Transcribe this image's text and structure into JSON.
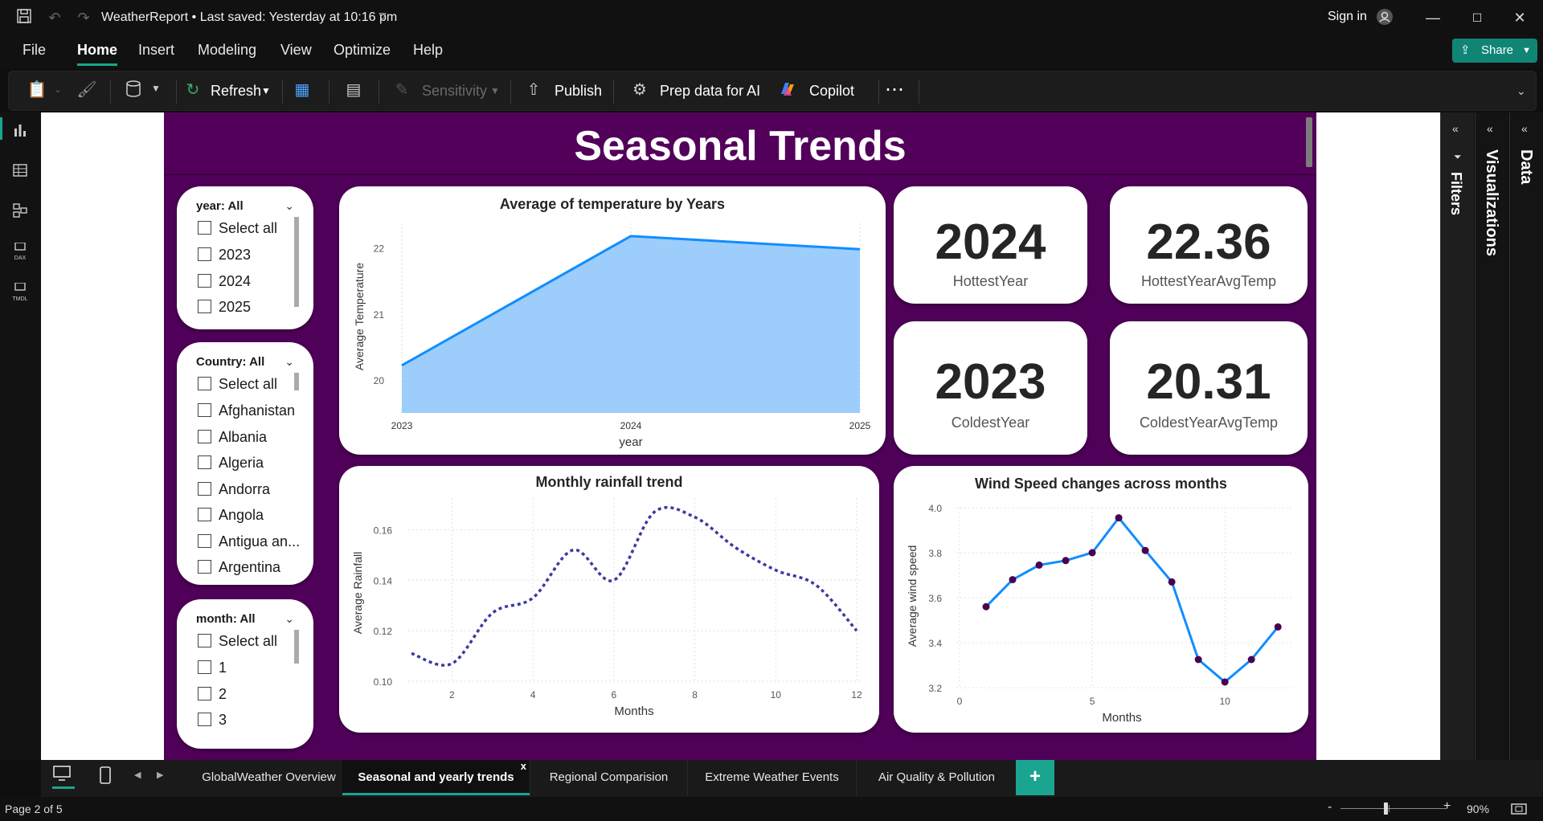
{
  "titlebar": {
    "title": "WeatherReport • Last saved: Yesterday at 10:16 pm",
    "sign_in": "Sign in"
  },
  "menu": {
    "items": [
      "File",
      "Home",
      "Insert",
      "Modeling",
      "View",
      "Optimize",
      "Help"
    ],
    "active": "Home",
    "share": "Share"
  },
  "ribbon": {
    "refresh": "Refresh",
    "sensitivity": "Sensitivity",
    "publish": "Publish",
    "prep_ai": "Prep data for AI",
    "copilot": "Copilot",
    "more": "⋯"
  },
  "report": {
    "title": "Seasonal Trends"
  },
  "slicers": {
    "year": {
      "header": "year: All",
      "items": [
        "Select all",
        "2023",
        "2024",
        "2025"
      ]
    },
    "country": {
      "header": "Country: All",
      "items": [
        "Select all",
        "Afghanistan",
        "Albania",
        "Algeria",
        "Andorra",
        "Angola",
        "Antigua an...",
        "Argentina"
      ]
    },
    "month": {
      "header": "month: All",
      "items": [
        "Select all",
        "1",
        "2",
        "3"
      ]
    }
  },
  "kpis": [
    {
      "value": "2024",
      "label": "HottestYear"
    },
    {
      "value": "22.36",
      "label": "HottestYearAvgTemp"
    },
    {
      "value": "2023",
      "label": "ColdestYear"
    },
    {
      "value": "20.31",
      "label": "ColdestYearAvgTemp"
    }
  ],
  "chart_data": [
    {
      "type": "area",
      "title": "Average of temperature by Years",
      "xlabel": "year",
      "ylabel": "Average Temperature",
      "categories": [
        "2023",
        "2024",
        "2025"
      ],
      "values": [
        20.22,
        22.18,
        21.98
      ],
      "yticks": [
        20,
        21,
        22
      ],
      "ylim": [
        19.5,
        22.3
      ],
      "colors": {
        "line": "#118dff",
        "fill": "#9ccdfb"
      }
    },
    {
      "type": "line",
      "title": "Monthly rainfall trend",
      "xlabel": "Months",
      "ylabel": "Average Rainfall",
      "x": [
        1,
        2,
        3,
        4,
        5,
        6,
        7,
        8,
        9,
        10,
        11,
        12
      ],
      "values": [
        0.111,
        0.107,
        0.127,
        0.133,
        0.152,
        0.14,
        0.167,
        0.165,
        0.153,
        0.144,
        0.138,
        0.12
      ],
      "xticks": [
        2,
        4,
        6,
        8,
        10,
        12
      ],
      "yticks": [
        0.1,
        0.12,
        0.14,
        0.16
      ],
      "ylim": [
        0.1,
        0.17
      ],
      "line_style": "dotted",
      "colors": {
        "line": "#3a3aa0"
      }
    },
    {
      "type": "line",
      "title": "Wind Speed changes across months",
      "xlabel": "Months",
      "ylabel": "Average wind speed",
      "x": [
        1,
        2,
        3,
        4,
        5,
        6,
        7,
        8,
        9,
        10,
        11,
        12
      ],
      "values": [
        3.56,
        3.68,
        3.745,
        3.765,
        3.8,
        3.955,
        3.81,
        3.67,
        3.325,
        3.225,
        3.325,
        3.47
      ],
      "xticks": [
        0,
        5,
        10
      ],
      "yticks": [
        3.2,
        3.4,
        3.6,
        3.8,
        4.0
      ],
      "ylim": [
        3.2,
        4.0
      ],
      "xlim": [
        0,
        12.6
      ],
      "markers": true,
      "colors": {
        "line": "#118dff",
        "marker": "#4a0050"
      }
    }
  ],
  "panes": {
    "filters": "Filters",
    "visualizations": "Visualizations",
    "data": "Data"
  },
  "tabs": {
    "items": [
      "GlobalWeather Overview",
      "Seasonal and yearly trends",
      "Regional Comparision",
      "Extreme Weather Events",
      "Air Quality & Pollution"
    ],
    "active_index": 1,
    "add": "+"
  },
  "status": {
    "page": "Page 2 of 5",
    "zoom": "90%"
  }
}
